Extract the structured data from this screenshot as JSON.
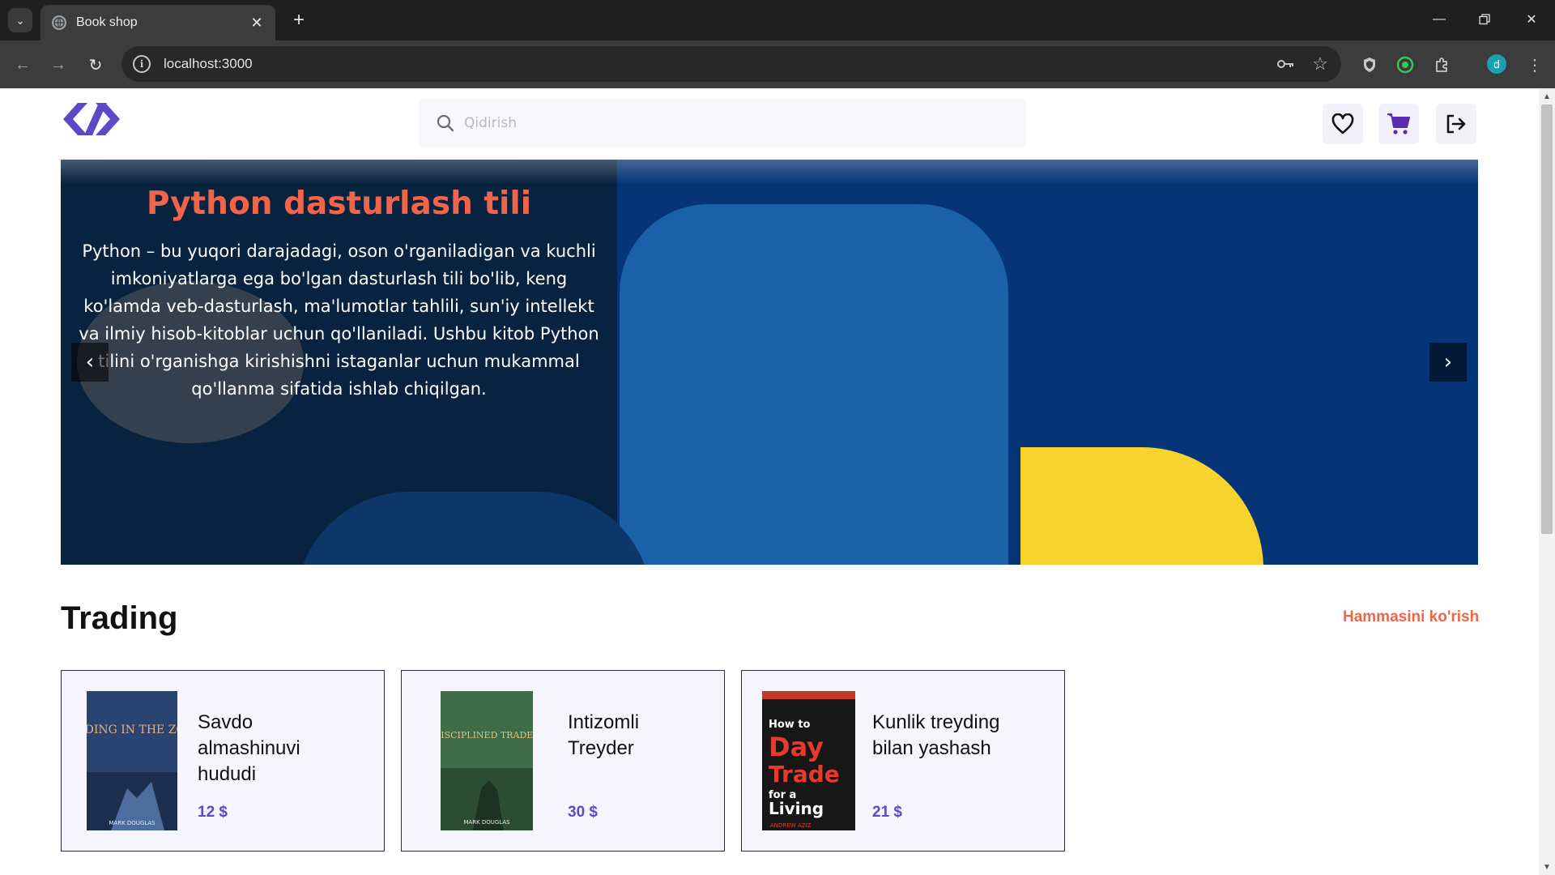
{
  "browser": {
    "tab_title": "Book shop",
    "url": "localhost:3000",
    "profile_initial": "d"
  },
  "header": {
    "search_placeholder": "Qidirish"
  },
  "hero": {
    "title": "Python dasturlash tili",
    "description": "Python – bu yuqori darajadagi, oson o'rganiladigan va kuchli imkoniyatlarga ega bo'lgan dasturlash tili bo'lib, keng ko'lamda veb-dasturlash, ma'lumotlar tahlili, sun'iy intellekt va ilmiy hisob-kitoblar uchun qo'llaniladi. Ushbu kitob Python tilini o'rganishga kirishishni istaganlar uchun mukammal qo'llanma sifatida ishlab chiqilgan.",
    "prev_arrow": "‹",
    "next_arrow": "›"
  },
  "section": {
    "title": "Trading",
    "see_all": "Hammasini ko'rish"
  },
  "books": [
    {
      "name": "Savdo almashinuvi hududi",
      "price": "12 $",
      "cover_title": "TRADING IN THE ZONE",
      "cover_author": "MARK DOUGLAS",
      "cover_color": "#2e4a78"
    },
    {
      "name": "Intizomli Treyder",
      "price": "30 $",
      "cover_title": "DISCIPLINED TRADER",
      "cover_author": "MARK DOUGLAS",
      "cover_color": "#3f6a4a"
    },
    {
      "name": "Kunlik treyding bilan yashash",
      "price": "21 $",
      "cover_title": "How to Day Trade for a Living",
      "cover_author": "ANDREW AZIZ",
      "cover_color": "#161616"
    }
  ],
  "colors": {
    "accent": "#f0654a",
    "brand": "#5b49c9",
    "card_bg": "#f6f5fd"
  }
}
